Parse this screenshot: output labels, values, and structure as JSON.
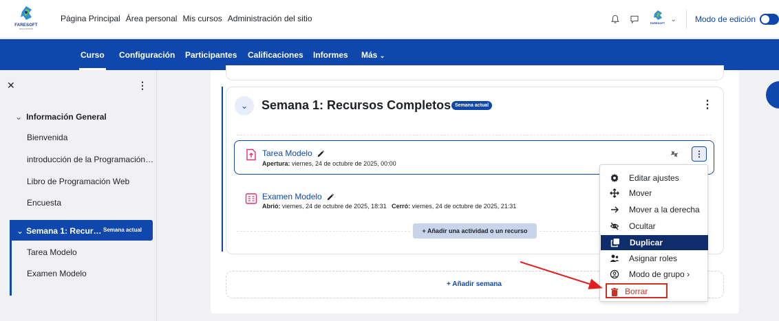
{
  "brand": {
    "name": "FARESOFT",
    "tagline": "SOLUTIONS",
    "avatar_text": "FARESOFT"
  },
  "topnav": [
    "Página Principal",
    "Área personal",
    "Mis cursos",
    "Administración del sitio"
  ],
  "topbar": {
    "edit_mode_label": "Modo de edición",
    "edit_mode_on": true
  },
  "secnav": [
    "Curso",
    "Configuración",
    "Participantes",
    "Calificaciones",
    "Informes",
    "Más"
  ],
  "drawer": {
    "section1": "Información General",
    "items1": [
      "Bienvenida",
      "introducción de la Programación…",
      "Libro de Programación Web",
      "Encuesta"
    ],
    "active_section": "Semana 1: Recur…",
    "active_badge": "Semana actual",
    "items2": [
      "Tarea Modelo",
      "Examen Modelo"
    ]
  },
  "section": {
    "title": "Semana 1: Recursos Completos",
    "badge": "Semana actual",
    "activities": [
      {
        "name": "Tarea Modelo",
        "meta_label": "Apertura:",
        "meta_value": "viernes, 24 de octubre de 2025, 00:00"
      },
      {
        "name": "Examen Modelo",
        "meta_label1": "Abrió:",
        "meta_value1": "viernes, 24 de octubre de 2025, 18:31",
        "meta_label2": "Cerró:",
        "meta_value2": "viernes, 24 de octubre de 2025, 21:31"
      }
    ],
    "add_activity": "+ Añadir una actividad o un recurso"
  },
  "add_week": "+ Añadir semana",
  "menu": [
    "Editar ajustes",
    "Mover",
    "Mover a la derecha",
    "Ocultar",
    "Duplicar",
    "Asignar roles",
    "Modo de grupo",
    "Borrar"
  ],
  "colors": {
    "primary": "#0f47ad",
    "danger": "#ca3120",
    "highlight": "#0f2c6b"
  }
}
